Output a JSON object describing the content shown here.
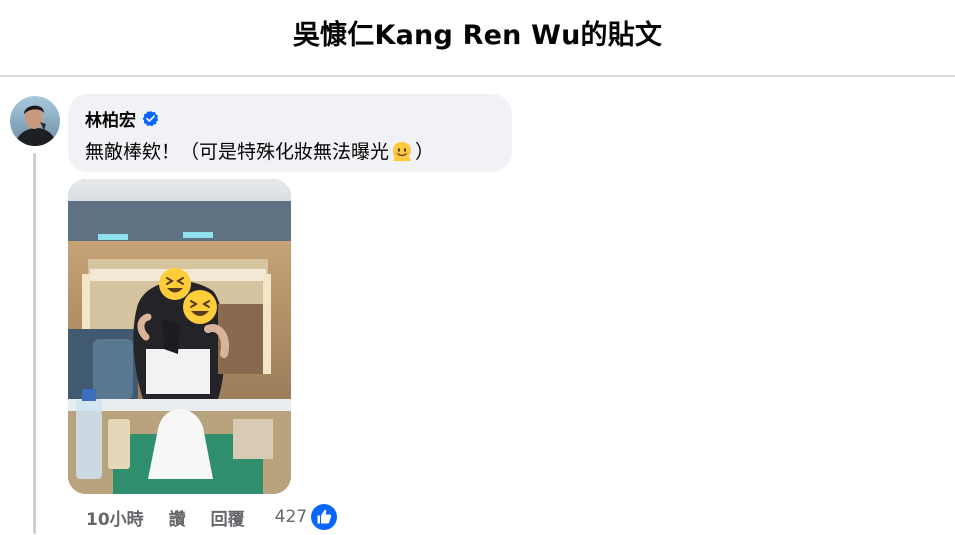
{
  "header": {
    "title": "吳慷仁Kang Ren Wu的貼文"
  },
  "comment": {
    "author": "林柏宏",
    "verified": true,
    "text_main": "無敵棒欸！（可是特殊化妝無法曝光",
    "text_end": "）",
    "emoji": "melting-face-icon",
    "photo_alt": "dressing room mirror selfie with emoji-covered faces"
  },
  "actions": {
    "time": "10小時",
    "like_label": "讚",
    "reply_label": "回覆",
    "reaction_count": "427",
    "reaction_icon": "like-thumb-icon"
  },
  "colors": {
    "bubble": "#f0f2f5",
    "meta_text": "#65676b",
    "verified_blue": "#0866ff",
    "divider": "#dadde1"
  }
}
